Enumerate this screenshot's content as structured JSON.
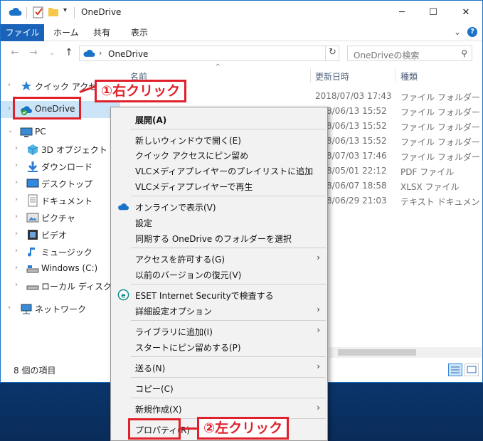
{
  "window": {
    "title": "OneDrive",
    "minimize_glyph": "─",
    "maximize_glyph": "☐",
    "close_glyph": "✕"
  },
  "ribbon": {
    "tabs": [
      "ファイル",
      "ホーム",
      "共有",
      "表示"
    ],
    "collapse_glyph": "⌄",
    "help_glyph": "?"
  },
  "address": {
    "back_glyph": "←",
    "forward_glyph": "→",
    "recent_glyph": "⌄",
    "up_glyph": "↑",
    "chevron": "›",
    "path": "OneDrive",
    "refresh_glyph": "↻",
    "search_placeholder": "OneDriveの検索",
    "search_glyph": "⚲"
  },
  "columns": {
    "name": "名前",
    "date": "更新日時",
    "type": "種類"
  },
  "nav": {
    "items": [
      {
        "label": "クイック アクセス",
        "icon": "star-icon"
      },
      {
        "label": "OneDrive",
        "icon": "onedrive-icon"
      },
      {
        "label": "PC",
        "icon": "pc-icon"
      },
      {
        "label": "3D オブジェクト",
        "icon": "3d-objects-icon"
      },
      {
        "label": "ダウンロード",
        "icon": "download-icon"
      },
      {
        "label": "デスクトップ",
        "icon": "desktop-icon"
      },
      {
        "label": "ドキュメント",
        "icon": "documents-icon"
      },
      {
        "label": "ピクチャ",
        "icon": "pictures-icon"
      },
      {
        "label": "ビデオ",
        "icon": "videos-icon"
      },
      {
        "label": "ミュージック",
        "icon": "music-icon"
      },
      {
        "label": "Windows (C:)",
        "icon": "drive-c-icon"
      },
      {
        "label": "ローカル ディスク (D:)",
        "icon": "drive-d-icon"
      },
      {
        "label": "ネットワーク",
        "icon": "network-icon"
      }
    ]
  },
  "files": [
    {
      "date": "2018/07/03 17:43",
      "type": "ファイル フォルダー"
    },
    {
      "date": "8/06/13 15:52",
      "type": "ファイル フォルダー"
    },
    {
      "date": "8/06/13 15:52",
      "type": "ファイル フォルダー"
    },
    {
      "date": "8/06/13 15:52",
      "type": "ファイル フォルダー"
    },
    {
      "date": "8/07/03 17:46",
      "type": "ファイル フォルダー"
    },
    {
      "date": "8/05/01 22:12",
      "type": "PDF ファイル"
    },
    {
      "date": "8/06/07 18:58",
      "type": "XLSX ファイル"
    },
    {
      "date": "8/06/29 21:03",
      "type": "テキスト ドキュメント"
    }
  ],
  "status": {
    "item_count": "8 個の項目"
  },
  "menu": {
    "expand": "展開(A)",
    "open_new_window": "新しいウィンドウで開く(E)",
    "pin_quick_access": "クイック アクセスにピン留め",
    "vlc_add_playlist": "VLCメディアプレイヤーのプレイリストに追加",
    "vlc_play": "VLCメディアプレイヤーで再生",
    "view_online": "オンラインで表示(V)",
    "settings": "設定",
    "choose_sync_folders": "同期する OneDrive のフォルダーを選択",
    "give_access": "アクセスを許可する(G)",
    "restore_previous": "以前のバージョンの復元(V)",
    "eset_scan": "ESET Internet Securityで検査する",
    "advanced_options": "詳細設定オプション",
    "include_library": "ライブラリに追加(I)",
    "pin_start": "スタートにピン留めする(P)",
    "send_to": "送る(N)",
    "copy": "コピー(C)",
    "new": "新規作成(X)",
    "properties": "プロパティ(R)",
    "submenu_arrow": "›"
  },
  "annotations": {
    "step1": "①右クリック",
    "step2": "②左クリック",
    "accent_color": "#e0202a"
  }
}
